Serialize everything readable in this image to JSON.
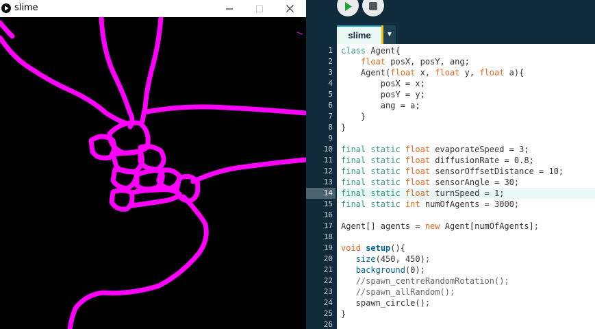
{
  "sketch_window": {
    "title": "slime",
    "controls": {
      "minimize": "minimize",
      "maximize": "maximize",
      "close": "close"
    },
    "canvas_colors": {
      "background": "#000000",
      "trail": "#ff00ff"
    }
  },
  "ide": {
    "toolbar": {
      "run_icon": "play-icon",
      "stop_icon": "stop-icon"
    },
    "tabs": [
      {
        "label": "slime"
      }
    ],
    "tab_menu_icon": "dropdown-arrow-icon",
    "current_line": 14,
    "colors": {
      "keyword": "#33997e",
      "type": "#e2661a",
      "function": "#006699",
      "comment": "#666666",
      "accent": "#f3c30b"
    },
    "lines": [
      {
        "n": "1",
        "t": [
          [
            "kw",
            "class"
          ],
          [
            "p",
            " Agent{"
          ]
        ]
      },
      {
        "n": "2",
        "t": [
          [
            "p",
            "    "
          ],
          [
            "type",
            "float"
          ],
          [
            "p",
            " posX, posY, ang;"
          ]
        ]
      },
      {
        "n": "3",
        "t": [
          [
            "p",
            "    Agent("
          ],
          [
            "type",
            "float"
          ],
          [
            "p",
            " x, "
          ],
          [
            "type",
            "float"
          ],
          [
            "p",
            " y, "
          ],
          [
            "type",
            "float"
          ],
          [
            "p",
            " a){"
          ]
        ]
      },
      {
        "n": "4",
        "t": [
          [
            "p",
            "        posX = x;"
          ]
        ]
      },
      {
        "n": "5",
        "t": [
          [
            "p",
            "        posY = y;"
          ]
        ]
      },
      {
        "n": "6",
        "t": [
          [
            "p",
            "        ang = a;"
          ]
        ]
      },
      {
        "n": "7",
        "t": [
          [
            "p",
            "    }"
          ]
        ]
      },
      {
        "n": "8",
        "t": [
          [
            "p",
            "}"
          ]
        ]
      },
      {
        "n": "9",
        "t": []
      },
      {
        "n": "10",
        "t": [
          [
            "kw",
            "final"
          ],
          [
            "p",
            " "
          ],
          [
            "kw",
            "static"
          ],
          [
            "p",
            " "
          ],
          [
            "type",
            "float"
          ],
          [
            "p",
            " evaporateSpeed = 3;"
          ]
        ]
      },
      {
        "n": "11",
        "t": [
          [
            "kw",
            "final"
          ],
          [
            "p",
            " "
          ],
          [
            "kw",
            "static"
          ],
          [
            "p",
            " "
          ],
          [
            "type",
            "float"
          ],
          [
            "p",
            " diffusionRate = 0.8;"
          ]
        ]
      },
      {
        "n": "12",
        "t": [
          [
            "kw",
            "final"
          ],
          [
            "p",
            " "
          ],
          [
            "kw",
            "static"
          ],
          [
            "p",
            " "
          ],
          [
            "type",
            "float"
          ],
          [
            "p",
            " sensorOffsetDistance = 10;"
          ]
        ]
      },
      {
        "n": "13",
        "t": [
          [
            "kw",
            "final"
          ],
          [
            "p",
            " "
          ],
          [
            "kw",
            "static"
          ],
          [
            "p",
            " "
          ],
          [
            "type",
            "float"
          ],
          [
            "p",
            " sensorAngle = 30;"
          ]
        ]
      },
      {
        "n": "14",
        "t": [
          [
            "kw",
            "final"
          ],
          [
            "p",
            " "
          ],
          [
            "kw",
            "static"
          ],
          [
            "p",
            " "
          ],
          [
            "type",
            "float"
          ],
          [
            "p",
            " turnSpeed = 1;"
          ]
        ]
      },
      {
        "n": "15",
        "t": [
          [
            "kw",
            "final"
          ],
          [
            "p",
            " "
          ],
          [
            "kw",
            "static"
          ],
          [
            "p",
            " "
          ],
          [
            "type",
            "int"
          ],
          [
            "p",
            " numOfAgents = 3000;"
          ]
        ]
      },
      {
        "n": "16",
        "t": []
      },
      {
        "n": "17",
        "t": [
          [
            "p",
            "Agent[] agents = "
          ],
          [
            "type",
            "new"
          ],
          [
            "p",
            " Agent[numOfAgents];"
          ]
        ]
      },
      {
        "n": "18",
        "t": []
      },
      {
        "n": "19",
        "t": [
          [
            "type",
            "void"
          ],
          [
            "p",
            " "
          ],
          [
            "fnb",
            "setup"
          ],
          [
            "p",
            "(){"
          ]
        ]
      },
      {
        "n": "20",
        "t": [
          [
            "p",
            "   "
          ],
          [
            "fn",
            "size"
          ],
          [
            "p",
            "(450, 450);"
          ]
        ]
      },
      {
        "n": "21",
        "t": [
          [
            "p",
            "   "
          ],
          [
            "fn",
            "background"
          ],
          [
            "p",
            "(0);"
          ]
        ]
      },
      {
        "n": "22",
        "t": [
          [
            "p",
            "   "
          ],
          [
            "cm",
            "//spawn_centreRandomRotation();"
          ]
        ]
      },
      {
        "n": "23",
        "t": [
          [
            "p",
            "   "
          ],
          [
            "cm",
            "//spawn_allRandom();"
          ]
        ]
      },
      {
        "n": "24",
        "t": [
          [
            "p",
            "   spawn_circle();"
          ]
        ]
      },
      {
        "n": "25",
        "t": [
          [
            "p",
            "}"
          ]
        ]
      },
      {
        "n": "26",
        "t": []
      }
    ]
  }
}
